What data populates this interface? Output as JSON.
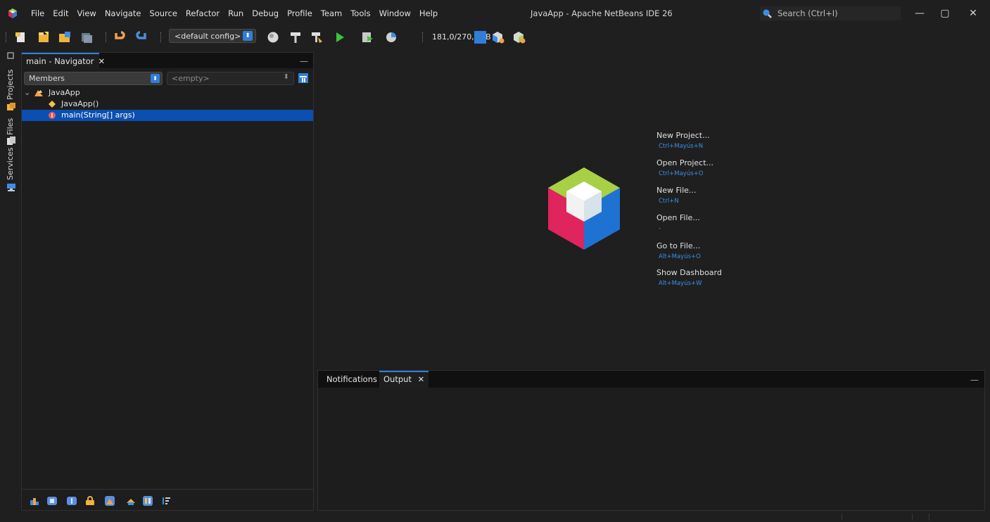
{
  "menu": [
    "File",
    "Edit",
    "View",
    "Navigate",
    "Source",
    "Refactor",
    "Run",
    "Debug",
    "Profile",
    "Team",
    "Tools",
    "Window",
    "Help"
  ],
  "window_title": "JavaApp - Apache NetBeans IDE 26",
  "search": {
    "placeholder": "Search (Ctrl+I)"
  },
  "window_controls": {
    "minimize": "—",
    "restore": "▢",
    "close": "✕"
  },
  "toolbar": {
    "config": "<default config>",
    "memory": "181,0/270,0MB"
  },
  "side_tabs": [
    "Projects",
    "Files",
    "Services"
  ],
  "navigator": {
    "tab_label": "main - Navigator",
    "close": "✕",
    "minimize": "—",
    "filter_select": "Members",
    "scope_select": "<empty>",
    "tree": [
      {
        "label": "JavaApp",
        "kind": "class",
        "expanded": true
      },
      {
        "label": "JavaApp()",
        "kind": "constructor"
      },
      {
        "label": "main(String[] args)",
        "kind": "method",
        "selected": true
      }
    ]
  },
  "quick_actions": [
    {
      "label": "New Project...",
      "shortcut": "Ctrl+Mayús+N"
    },
    {
      "label": "Open Project...",
      "shortcut": "Ctrl+Mayús+O"
    },
    {
      "label": "New File...",
      "shortcut": "Ctrl+N"
    },
    {
      "label": "Open File...",
      "shortcut": "-"
    },
    {
      "label": "Go to File...",
      "shortcut": "Alt+Mayús+O"
    },
    {
      "label": "Show Dashboard",
      "shortcut": "Alt+Mayús+W"
    }
  ],
  "output_panel": {
    "tabs": [
      {
        "label": "Notifications",
        "active": false
      },
      {
        "label": "Output",
        "active": true,
        "close": "✕"
      }
    ],
    "minimize": "—"
  },
  "colors": {
    "accent": "#2f7fd8",
    "selection": "#0b4fb0",
    "background": "#1f1f1f"
  }
}
